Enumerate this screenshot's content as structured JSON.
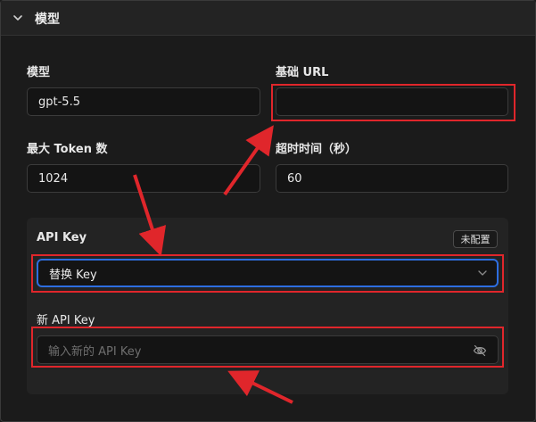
{
  "section": {
    "title": "模型"
  },
  "fields": {
    "model": {
      "label": "模型",
      "value": "gpt-5.5"
    },
    "base_url": {
      "label": "基础 URL",
      "value": ""
    },
    "max_tokens": {
      "label": "最大 Token 数",
      "value": "1024"
    },
    "timeout": {
      "label": "超时时间（秒）",
      "value": "60"
    }
  },
  "api_key": {
    "label": "API Key",
    "status_badge": "未配置",
    "select_value": "替换 Key",
    "new_label": "新 API Key",
    "new_placeholder": "输入新的 API Key"
  },
  "colors": {
    "accent": "#2d6ee0",
    "annotation": "#e0262b"
  },
  "icons": {
    "header": "chevron-down-icon",
    "select": "chevron-down-icon",
    "password_toggle": "eye-off-icon"
  }
}
